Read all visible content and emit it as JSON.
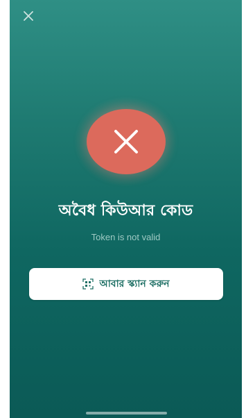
{
  "header": {
    "close_icon": "close-icon"
  },
  "status": {
    "icon": "error-x-icon",
    "title": "অবৈধ কিউআর কোড",
    "message": "Token is not valid"
  },
  "actions": {
    "rescan_icon": "qr-scan-icon",
    "rescan_label": "আবার স্ক্যান করুন"
  },
  "colors": {
    "background_top": "#2f8f85",
    "background_bottom": "#0b5a56",
    "error_circle": "#dc6a5c",
    "button_text": "#1c6e63"
  }
}
